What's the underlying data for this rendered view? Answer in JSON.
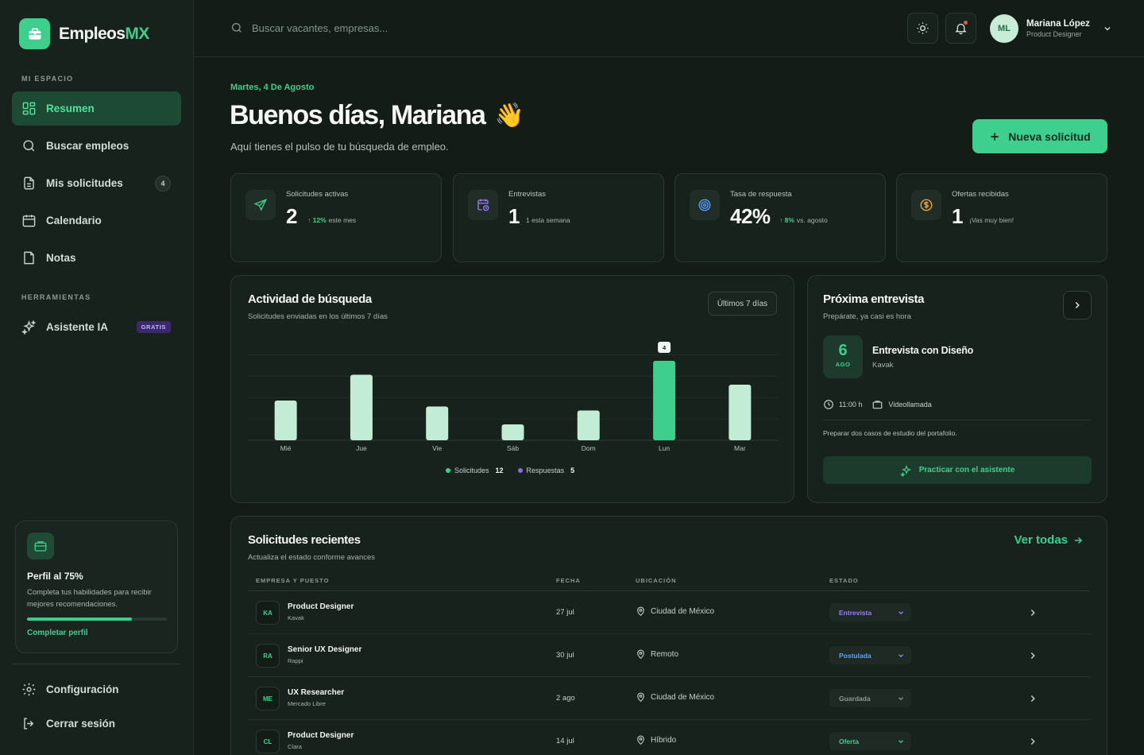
{
  "brand": {
    "name": "Empleos",
    "accent": "MX",
    "color": "#3ecf8e"
  },
  "sidebar": {
    "section_main": "MI ESPACIO",
    "items": [
      {
        "label": "Resumen",
        "icon": "grid-icon",
        "active": true
      },
      {
        "label": "Buscar empleos",
        "icon": "search-icon"
      },
      {
        "label": "Mis solicitudes",
        "icon": "document-icon",
        "badge": "4"
      },
      {
        "label": "Calendario",
        "icon": "calendar-icon"
      },
      {
        "label": "Notas",
        "icon": "note-icon"
      }
    ],
    "section_tools": "HERRAMIENTAS",
    "assistant": {
      "label": "Asistente IA",
      "badge": "GRATIS",
      "icon": "sparkles-icon"
    },
    "profile": {
      "title": "Perfil al 75%",
      "description": "Completa tus habilidades para recibir mejores recomendaciones.",
      "progress": 0.75,
      "link": "Completar perfil"
    },
    "settings": "Configuración",
    "logout": "Cerrar sesión"
  },
  "topbar": {
    "search_placeholder": "Buscar vacantes, empresas...",
    "user": {
      "initials": "ML",
      "name": "Mariana López",
      "role": "Product Designer"
    }
  },
  "header": {
    "date": "Martes, 4 De Agosto",
    "greeting": "Buenos días, Mariana",
    "emoji": "👋",
    "subtitle": "Aquí tienes el pulso de tu búsqueda de empleo.",
    "new_button": "Nueva solicitud"
  },
  "stats": [
    {
      "label": "Solicitudes activas",
      "value": "2",
      "trend": "12%",
      "note": "este mes",
      "icon": "send-icon"
    },
    {
      "label": "Entrevistas",
      "value": "1",
      "trend": "",
      "note": "1 esta semana",
      "icon": "calendar-clock-icon"
    },
    {
      "label": "Tasa de respuesta",
      "value": "42%",
      "trend": "8%",
      "note": "vs. agosto",
      "icon": "target-icon"
    },
    {
      "label": "Ofertas recibidas",
      "value": "1",
      "trend": "",
      "note": "¡Vas muy bien!",
      "icon": "dollar-icon"
    }
  ],
  "activity": {
    "title": "Actividad de búsqueda",
    "subtitle": "Solicitudes enviadas en los últimos 7 días",
    "range": "Últimos 7 días",
    "legend": [
      {
        "name": "Solicitudes",
        "value": "12",
        "color": "#3ecf8e"
      },
      {
        "name": "Respuestas",
        "value": "5",
        "color": "#8b6cf0"
      }
    ]
  },
  "chart_data": {
    "type": "bar",
    "categories": [
      "Mié",
      "Jue",
      "Vie",
      "Sáb",
      "Dom",
      "Lun",
      "Mar"
    ],
    "values": [
      2,
      3.3,
      1.7,
      0.8,
      1.5,
      4,
      2.8
    ],
    "highlight_index": 5,
    "highlight_label": "4",
    "ylim": [
      0,
      4.6
    ],
    "grid": true
  },
  "interview": {
    "title": "Próxima entrevista",
    "subtitle": "Prepárate, ya casi es hora",
    "day": "6",
    "month": "AGO",
    "name": "Entrevista con Diseño",
    "company": "Kavak",
    "time": "11:00 h",
    "mode": "Videollamada",
    "note": "Preparar dos casos de estudio del portafolio.",
    "practice": "Practicar con el asistente"
  },
  "recent": {
    "title": "Solicitudes recientes",
    "subtitle": "Actualiza el estado conforme avances",
    "see_all": "Ver todas",
    "columns": [
      "EMPRESA Y PUESTO",
      "FECHA",
      "UBICACIÓN",
      "ESTADO"
    ],
    "rows": [
      {
        "initials": "KA",
        "title": "Product Designer",
        "company": "Kavak",
        "date": "27 jul",
        "location": "Ciudad de México",
        "status": "Entrevista",
        "status_color": "#9b7cff"
      },
      {
        "initials": "RA",
        "title": "Senior UX Designer",
        "company": "Rappi",
        "date": "30 jul",
        "location": "Remoto",
        "status": "Postulada",
        "status_color": "#5aa2ff"
      },
      {
        "initials": "ME",
        "title": "UX Researcher",
        "company": "Mercado Libre",
        "date": "2 ago",
        "location": "Ciudad de México",
        "status": "Guardada",
        "status_color": "#8c9a92"
      },
      {
        "initials": "CL",
        "title": "Product Designer",
        "company": "Clara",
        "date": "14 jul",
        "location": "Híbrido",
        "status": "Oferta",
        "status_color": "#3ecf8e"
      }
    ]
  }
}
